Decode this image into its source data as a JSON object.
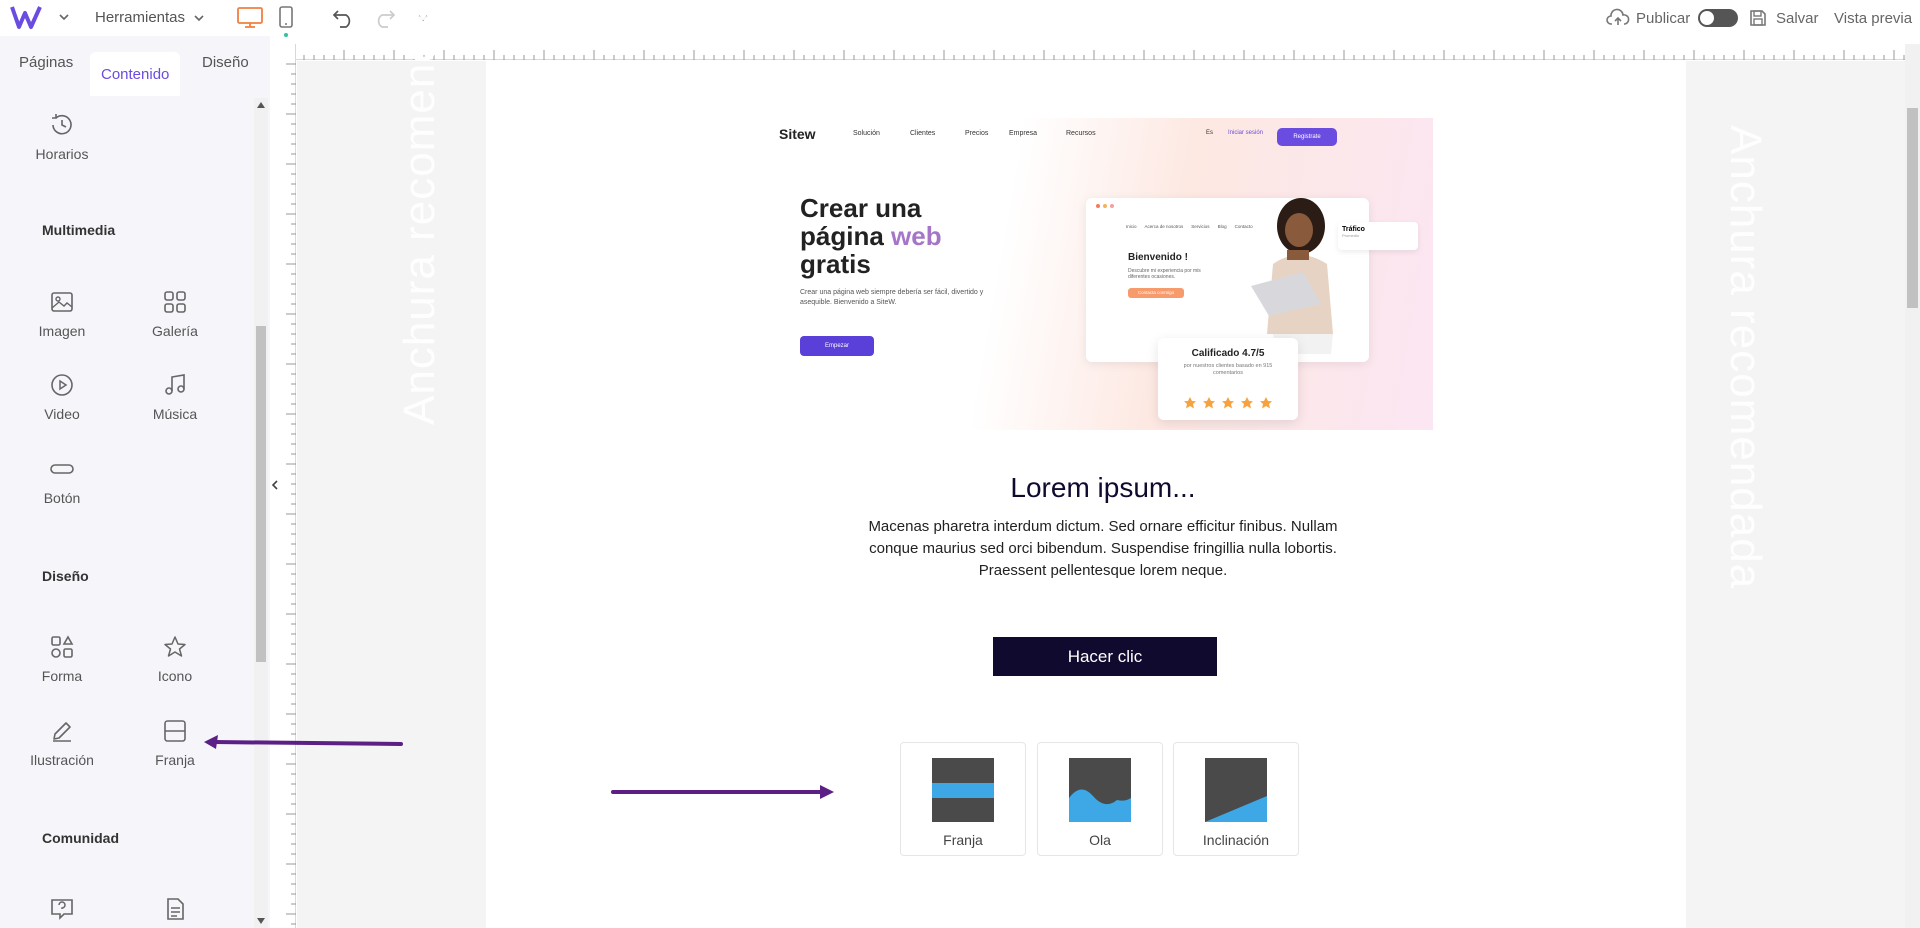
{
  "topbar": {
    "logo": "W",
    "tools_label": "Herramientas",
    "publish_label": "Publicar",
    "save_label": "Salvar",
    "preview_label": "Vista previa"
  },
  "left_panel": {
    "tabs": [
      {
        "label": "Páginas"
      },
      {
        "label": "Contenido",
        "active": true
      },
      {
        "label": "Diseño"
      }
    ],
    "items": {
      "horarios": "Horarios",
      "multimedia_title": "Multimedia",
      "imagen": "Imagen",
      "galeria": "Galería",
      "video": "Video",
      "musica": "Música",
      "boton": "Botón",
      "diseno_title": "Diseño",
      "forma": "Forma",
      "icono": "Icono",
      "ilustracion": "Ilustración",
      "franja": "Franja",
      "comunidad_title": "Comunidad"
    }
  },
  "canvas": {
    "recommended_left": "Anchura recomendada",
    "recommended_right": "Anchura recomendada"
  },
  "hero": {
    "logo": "Sitew",
    "nav": [
      "Solución",
      "Clientes",
      "Precios",
      "Empresa",
      "Recursos"
    ],
    "lang": "Es",
    "login": "Iniciar sesión",
    "register": "Registrate",
    "title_1": "Crear una",
    "title_2": "página",
    "title_web": "web",
    "title_3": "gratis",
    "desc": "Crear una página web siempre debería ser fácil, divertido y asequible. Bienvenido a SiteW.",
    "cta": "Empezar",
    "mock_nav": [
      "Inicio",
      "Acerca de nosotros",
      "Servicios",
      "Blog",
      "Contacto"
    ],
    "welcome": "Bienvenido !",
    "welcome_desc": "Descubre mi experiencia por mis diferentes ocasiones.",
    "welcome_btn": "Contacta conmigo",
    "rated_title": "Calificado 4.7/5",
    "rated_desc": "por nuestros clientes basado en 915 comentarios",
    "traffic": "Tráfico",
    "traffic_sub": "Promedio"
  },
  "content": {
    "title": "Lorem ipsum...",
    "body": "Macenas pharetra interdum dictum. Sed ornare efficitur finibus. Nullam conque maurius sed orci bibendum. Suspendise fringillia nulla lobortis. Praessent pellentesque lorem neque.",
    "button": "Hacer clic"
  },
  "band_options": [
    {
      "label": "Franja"
    },
    {
      "label": "Ola"
    },
    {
      "label": "Inclinación"
    }
  ],
  "colors": {
    "accent": "#6b4ce0",
    "dark_button": "#0f0a2e",
    "band_blue": "#3ea8e6",
    "arrow": "#5b1f86"
  }
}
